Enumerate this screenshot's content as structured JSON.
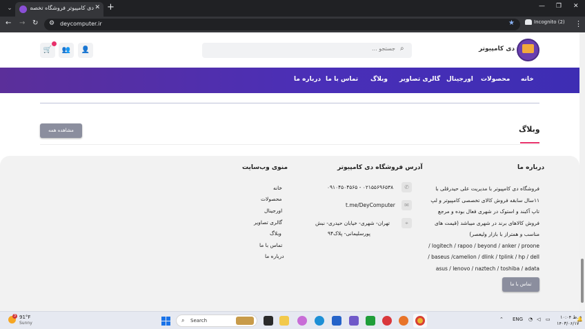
{
  "browser": {
    "tab_title": "دی کامپیوتر فروشگاه تخصصی ل...",
    "url": "deycomputer.ir",
    "profile_label": "Incognito (2)"
  },
  "header": {
    "site_name": "دی کامپیوتر",
    "search_placeholder": "جستجو ..."
  },
  "nav": {
    "items": [
      "خانه",
      "محصولات",
      "اورجینال",
      "گالری تصاویر",
      "وبلاگ",
      "تماس با ما",
      "درباره ما"
    ]
  },
  "blog": {
    "title": "وبلاگ",
    "see_all_label": "مشاهده همه"
  },
  "footer": {
    "about_title": "درباره ما",
    "about_lines": [
      "فروشگاه دی کامپیوتر با مدیریت علی حیدرقلی با",
      "۱۱سال سابقه فروش کالای تخصصی کامپیوتر و لپ",
      "تاپ آکبند و استوک در شهری فعال بوده و مرجع",
      "فروش کالاهای برند در شهری میباشد (قیمت های",
      "مناسب و همتراز با بازار ولیعصر)",
      "logitech / rapoo / beyond / anker / proone /",
      "baseus /camelion / dlink / tplink / hp / dell /",
      "asus / lenovo / naztech / toshiba / adata"
    ],
    "address_title": "آدرس فروشگاه دی کامپیوتر",
    "phone": "۰۲۱۵۵۶۹۶۵۳۸ - ۰۹۱۰۴۵۰۴۵۶۵",
    "telegram": "t.me/DeyComputer",
    "address_lines": [
      "تهران- شهری- خیابان حیدری- نبش",
      "پورسلیمانی- پلاک۹۴"
    ],
    "menu_title": "منوی وب‌سایت",
    "menu_items": [
      "خانه",
      "محصولات",
      "اورجینال",
      "گالری تصاویر",
      "وبلاگ",
      "تماس با ما",
      "درباره ما"
    ],
    "contact_button": "تماس با ما"
  },
  "taskbar": {
    "weather_temp": "91°F",
    "weather_desc": "Sunny",
    "weather_badge": "3",
    "search_label": "Search",
    "language": "ENG",
    "time": "۱۰:۰۴ ق.ظ",
    "date": "۱۴۰۳/۰۶/۱۷"
  },
  "colors": {
    "nav_gradient_start": "#5b2f9a",
    "nav_gradient_end": "#3d2db3",
    "accent_pink": "#e8316b",
    "button_gray": "#8b8e9e",
    "footer_bg": "#f2f2f2"
  }
}
